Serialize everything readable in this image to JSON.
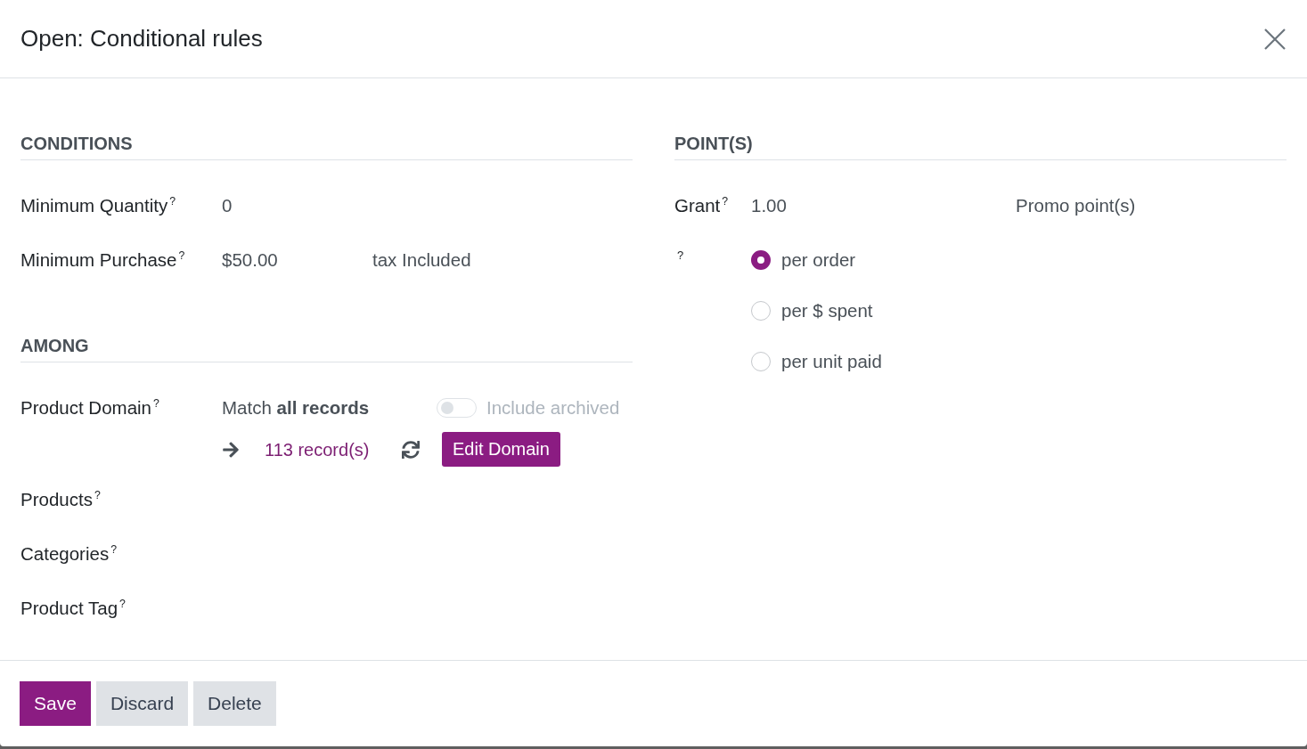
{
  "dialog": {
    "title": "Open: Conditional rules"
  },
  "conditions": {
    "heading": "CONDITIONS",
    "fields": [
      {
        "label": "Minimum Quantity$^{?}$",
        "value": "0"
      },
      {
        "label": "Minimum Purchase$^{?}$",
        "value": "$50.00",
        "suffix": "tax Included"
      }
    ]
  },
  "among": {
    "heading": "AMONG",
    "product_domain": {
      "label": "Product Domain$^{?}$",
      "match_text": "Match **all records**",
      "include_archived": {
        "label": "Include archived",
        "on": false,
        "disabled": true
      },
      "record_count": "113 record(s)",
      "edit_button": "Edit Domain"
    },
    "fields": [
      {
        "label": "Products$^{?}$"
      },
      {
        "label": "Categories$^{?}$"
      },
      {
        "label": "Product Tag$^{?}$"
      }
    ]
  },
  "points": {
    "heading": "POINT(S)",
    "grant": {
      "label": "Grant$^{?}$",
      "value": "1.00",
      "unit": "Promo point(s)"
    },
    "mode": {
      "label": "?",
      "options": [
        {
          "label": "per order",
          "selected": true
        },
        {
          "label": "per $ spent",
          "selected": false
        },
        {
          "label": "per unit paid",
          "selected": false
        }
      ]
    }
  },
  "footer": {
    "buttons": [
      {
        "label": "Save",
        "kind": "primary"
      },
      {
        "label": "Discard",
        "kind": "secondary"
      },
      {
        "label": "Delete",
        "kind": "secondary"
      }
    ]
  }
}
